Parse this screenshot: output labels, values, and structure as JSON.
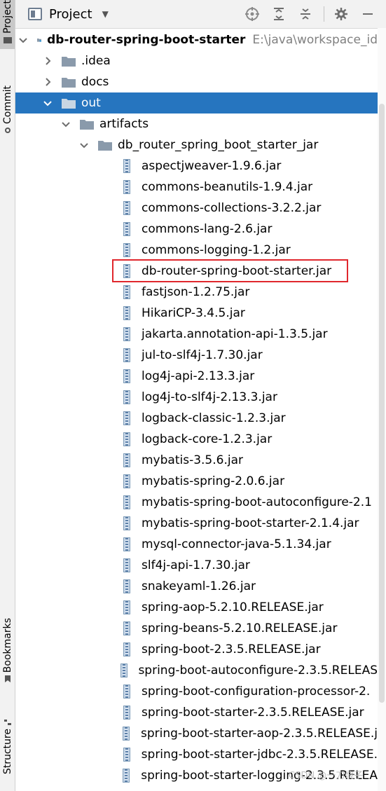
{
  "sidebar": {
    "tabs": [
      {
        "label": "Project",
        "active": true
      },
      {
        "label": "Commit",
        "active": false
      },
      {
        "label": "Bookmarks",
        "active": false
      },
      {
        "label": "Structure",
        "active": false
      }
    ]
  },
  "header": {
    "title": "Project",
    "tools": [
      "target-icon",
      "expand-all-icon",
      "collapse-all-icon",
      "gear-icon",
      "minimize-icon"
    ]
  },
  "tree": {
    "root": {
      "label": "db-router-spring-boot-starter",
      "path": "E:\\java\\workspace_id"
    },
    "folders": [
      {
        "label": ".idea",
        "expanded": false,
        "selected": false
      },
      {
        "label": "docs",
        "expanded": false,
        "selected": false
      },
      {
        "label": "out",
        "expanded": true,
        "selected": true
      },
      {
        "label": "artifacts",
        "expanded": true,
        "selected": false
      },
      {
        "label": "db_router_spring_boot_starter_jar",
        "expanded": true,
        "selected": false
      }
    ],
    "jars": [
      "aspectjweaver-1.9.6.jar",
      "commons-beanutils-1.9.4.jar",
      "commons-collections-3.2.2.jar",
      "commons-lang-2.6.jar",
      "commons-logging-1.2.jar",
      "db-router-spring-boot-starter.jar",
      "fastjson-1.2.75.jar",
      "HikariCP-3.4.5.jar",
      "jakarta.annotation-api-1.3.5.jar",
      "jul-to-slf4j-1.7.30.jar",
      "log4j-api-2.13.3.jar",
      "log4j-to-slf4j-2.13.3.jar",
      "logback-classic-1.2.3.jar",
      "logback-core-1.2.3.jar",
      "mybatis-3.5.6.jar",
      "mybatis-spring-2.0.6.jar",
      "mybatis-spring-boot-autoconfigure-2.1",
      "mybatis-spring-boot-starter-2.1.4.jar",
      "mysql-connector-java-5.1.34.jar",
      "slf4j-api-1.7.30.jar",
      "snakeyaml-1.26.jar",
      "spring-aop-5.2.10.RELEASE.jar",
      "spring-beans-5.2.10.RELEASE.jar",
      "spring-boot-2.3.5.RELEASE.jar",
      "spring-boot-autoconfigure-2.3.5.RELEAS",
      "spring-boot-configuration-processor-2.",
      "spring-boot-starter-2.3.5.RELEASE.jar",
      "spring-boot-starter-aop-2.3.5.RELEASE.j",
      "spring-boot-starter-jdbc-2.3.5.RELEASE.",
      "spring-boot-starter-logging-2.3.5.RELEA"
    ],
    "highlighted_jar": "db-router-spring-boot-starter.jar"
  },
  "watermark": "CSDN @一刀烧子",
  "colors": {
    "selection": "#2675bf",
    "highlight_box": "#e0272d",
    "jar_text": "#000000"
  }
}
